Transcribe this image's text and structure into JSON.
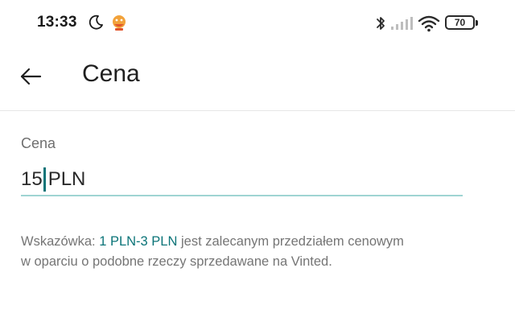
{
  "status_bar": {
    "time": "13:33",
    "battery_level": "70"
  },
  "app_bar": {
    "title": "Cena"
  },
  "price_field": {
    "label": "Cena",
    "value": "15",
    "currency": "PLN"
  },
  "hint": {
    "prefix": "Wskazówka: ",
    "range": "1 PLN-3 PLN",
    "suffix": " jest zalecanym przedziałem cenowym",
    "line2": "w oparciu o podobne rzeczy sprzedawane na Vinted."
  },
  "colors": {
    "accent": "#0b7478",
    "underline": "#9fd4d3"
  }
}
